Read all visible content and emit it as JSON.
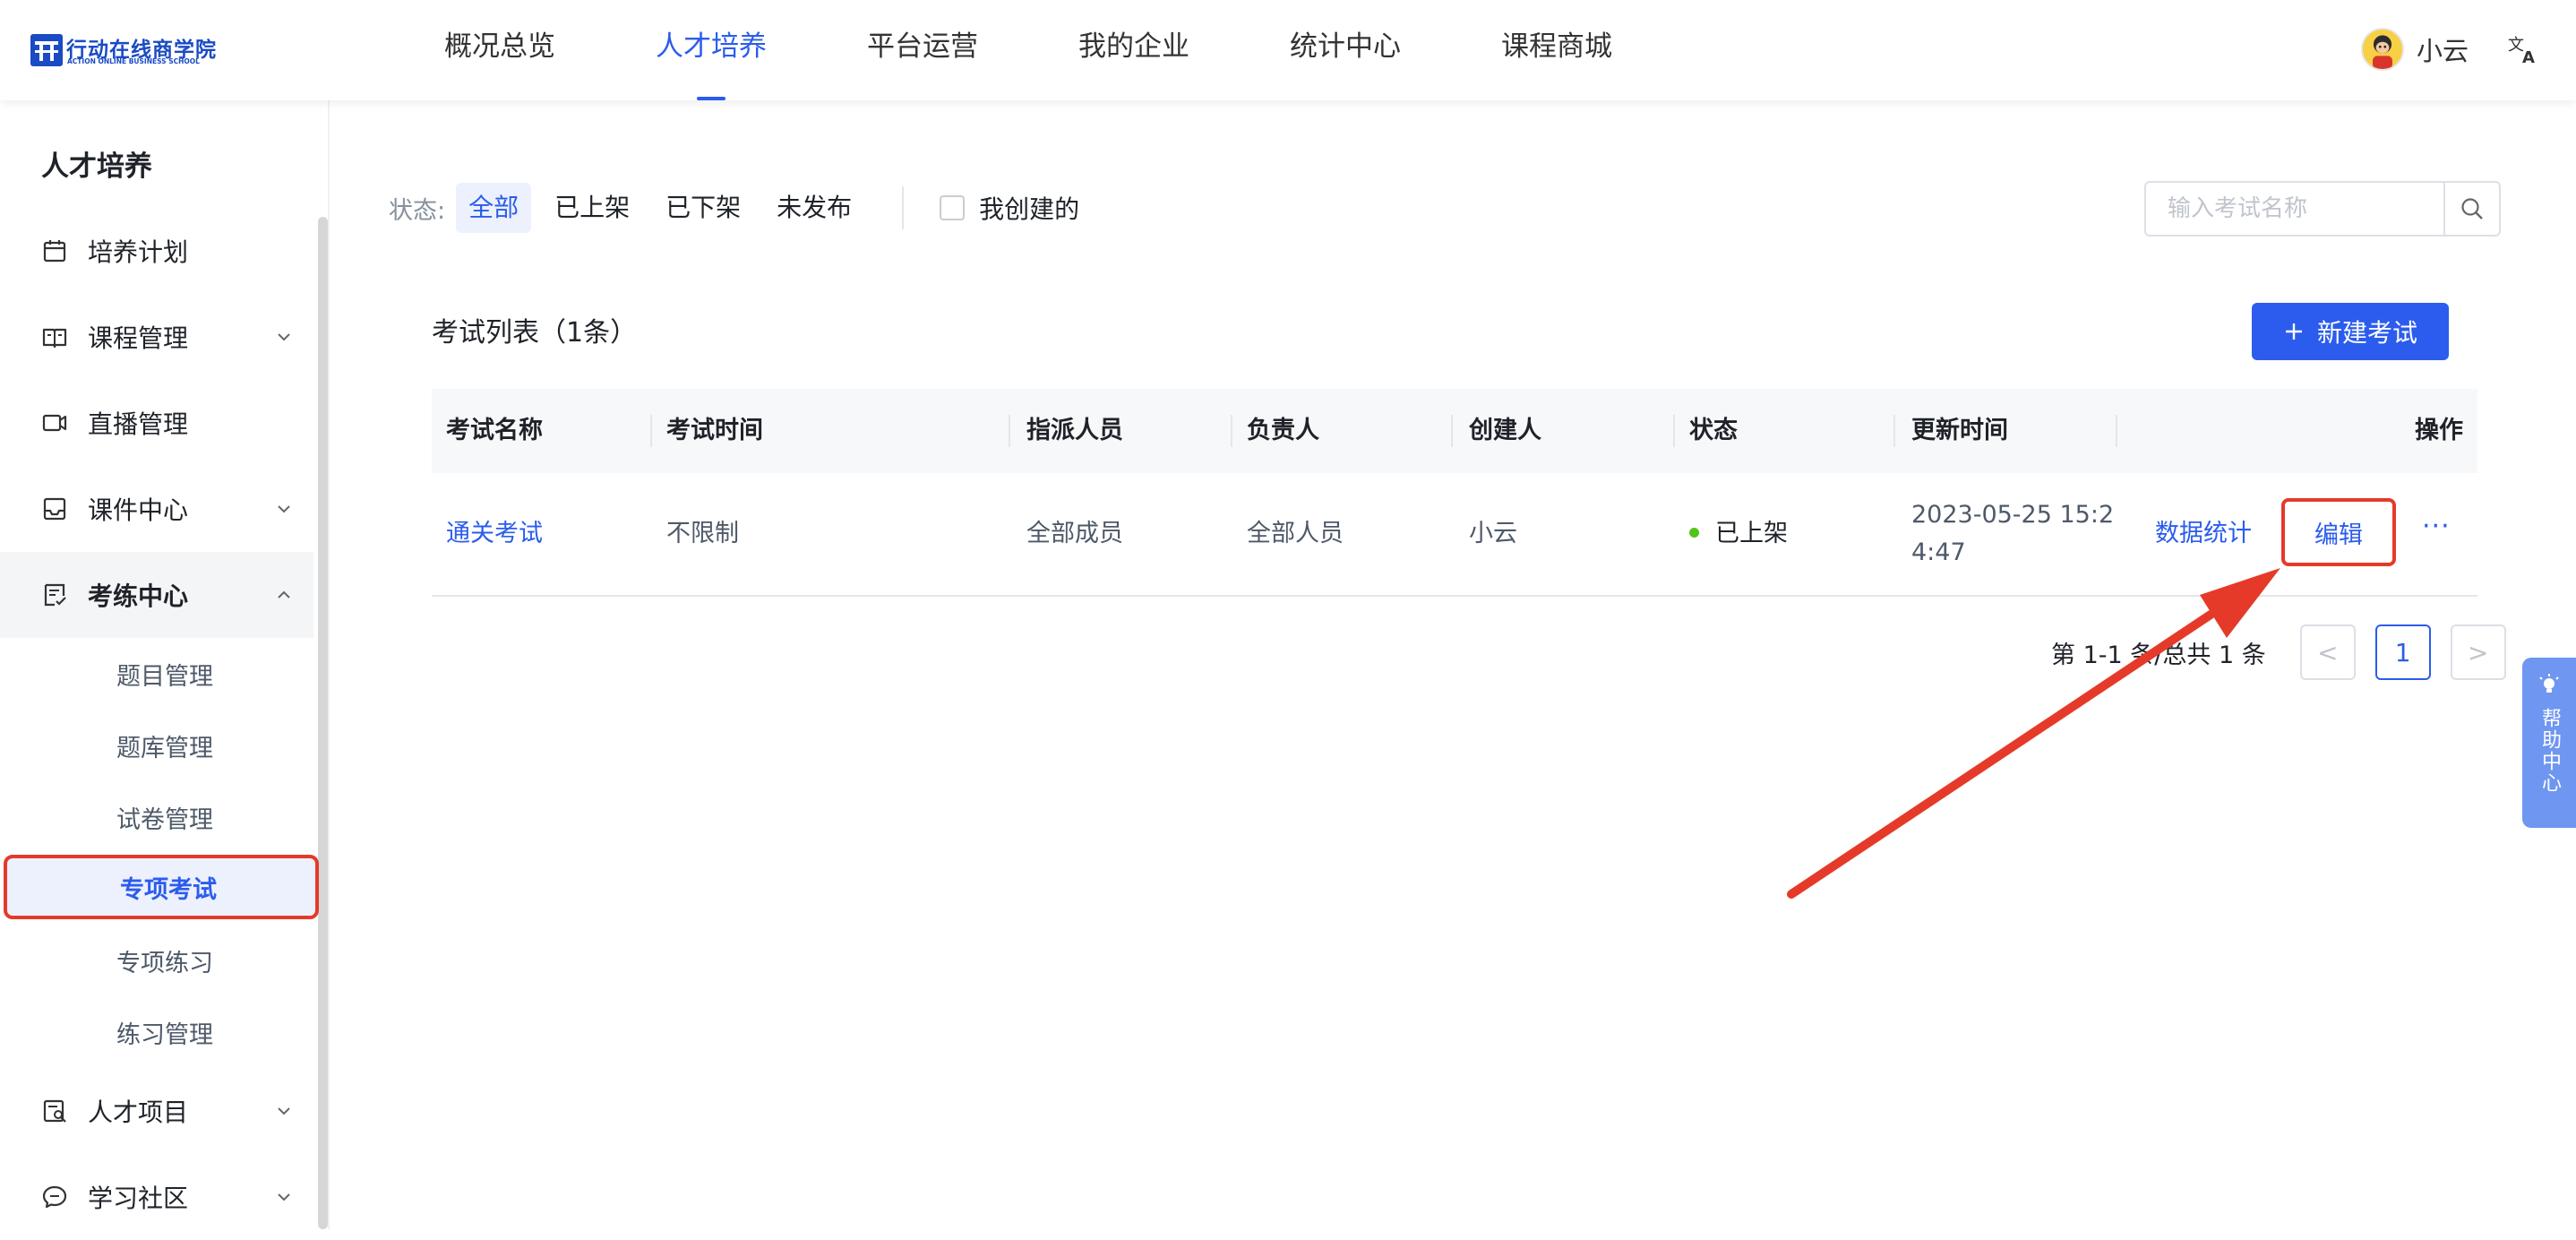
{
  "header": {
    "logo_text": "行动在线商学院",
    "logo_subtext": "ACTION ONLINE BUSINESS SCHOOL",
    "nav": [
      "概况总览",
      "人才培养",
      "平台运营",
      "我的企业",
      "统计中心",
      "课程商城"
    ],
    "active_nav": "人才培养",
    "user_name": "小云"
  },
  "sidebar": {
    "title": "人才培养",
    "items": [
      {
        "label": "培养计划",
        "icon": "calendar-icon"
      },
      {
        "label": "课程管理",
        "icon": "book-icon"
      },
      {
        "label": "直播管理",
        "icon": "video-camera-icon"
      },
      {
        "label": "课件中心",
        "icon": "inbox-icon"
      },
      {
        "label": "考练中心",
        "icon": "checklist-icon"
      },
      {
        "label": "人才项目",
        "icon": "person-search-icon"
      },
      {
        "label": "学习社区",
        "icon": "chat-icon"
      }
    ],
    "subitems": [
      "题目管理",
      "题库管理",
      "试卷管理",
      "专项考试",
      "专项练习",
      "练习管理"
    ],
    "active_subitem": "专项考试"
  },
  "filter": {
    "label": "状态:",
    "options": [
      "全部",
      "已上架",
      "已下架",
      "未发布"
    ],
    "active": "全部",
    "checkbox_label": "我创建的"
  },
  "search": {
    "placeholder": "输入考试名称"
  },
  "list": {
    "title": "考试列表（1条）",
    "new_button": "新建考试",
    "columns": [
      "考试名称",
      "考试时间",
      "指派人员",
      "负责人",
      "创建人",
      "状态",
      "更新时间",
      "操作"
    ],
    "rows": [
      {
        "name": "通关考试",
        "time": "不限制",
        "assignees": "全部成员",
        "owner": "全部人员",
        "creator": "小云",
        "status": "已上架",
        "updated_line1": "2023-05-25 15:2",
        "updated_line2": "4:47",
        "action_stats": "数据统计",
        "action_edit": "编辑",
        "action_more": "···"
      }
    ]
  },
  "pagination": {
    "info": "第 1-1 条/总共 1 条",
    "current_page": "1",
    "prev": "<",
    "next": ">"
  },
  "help_widget": {
    "label": "帮助中心"
  },
  "colors": {
    "primary": "#2b5ced",
    "highlight": "#e53a2a",
    "status_dot": "#52c41a",
    "help_bg": "#6f96f0"
  }
}
